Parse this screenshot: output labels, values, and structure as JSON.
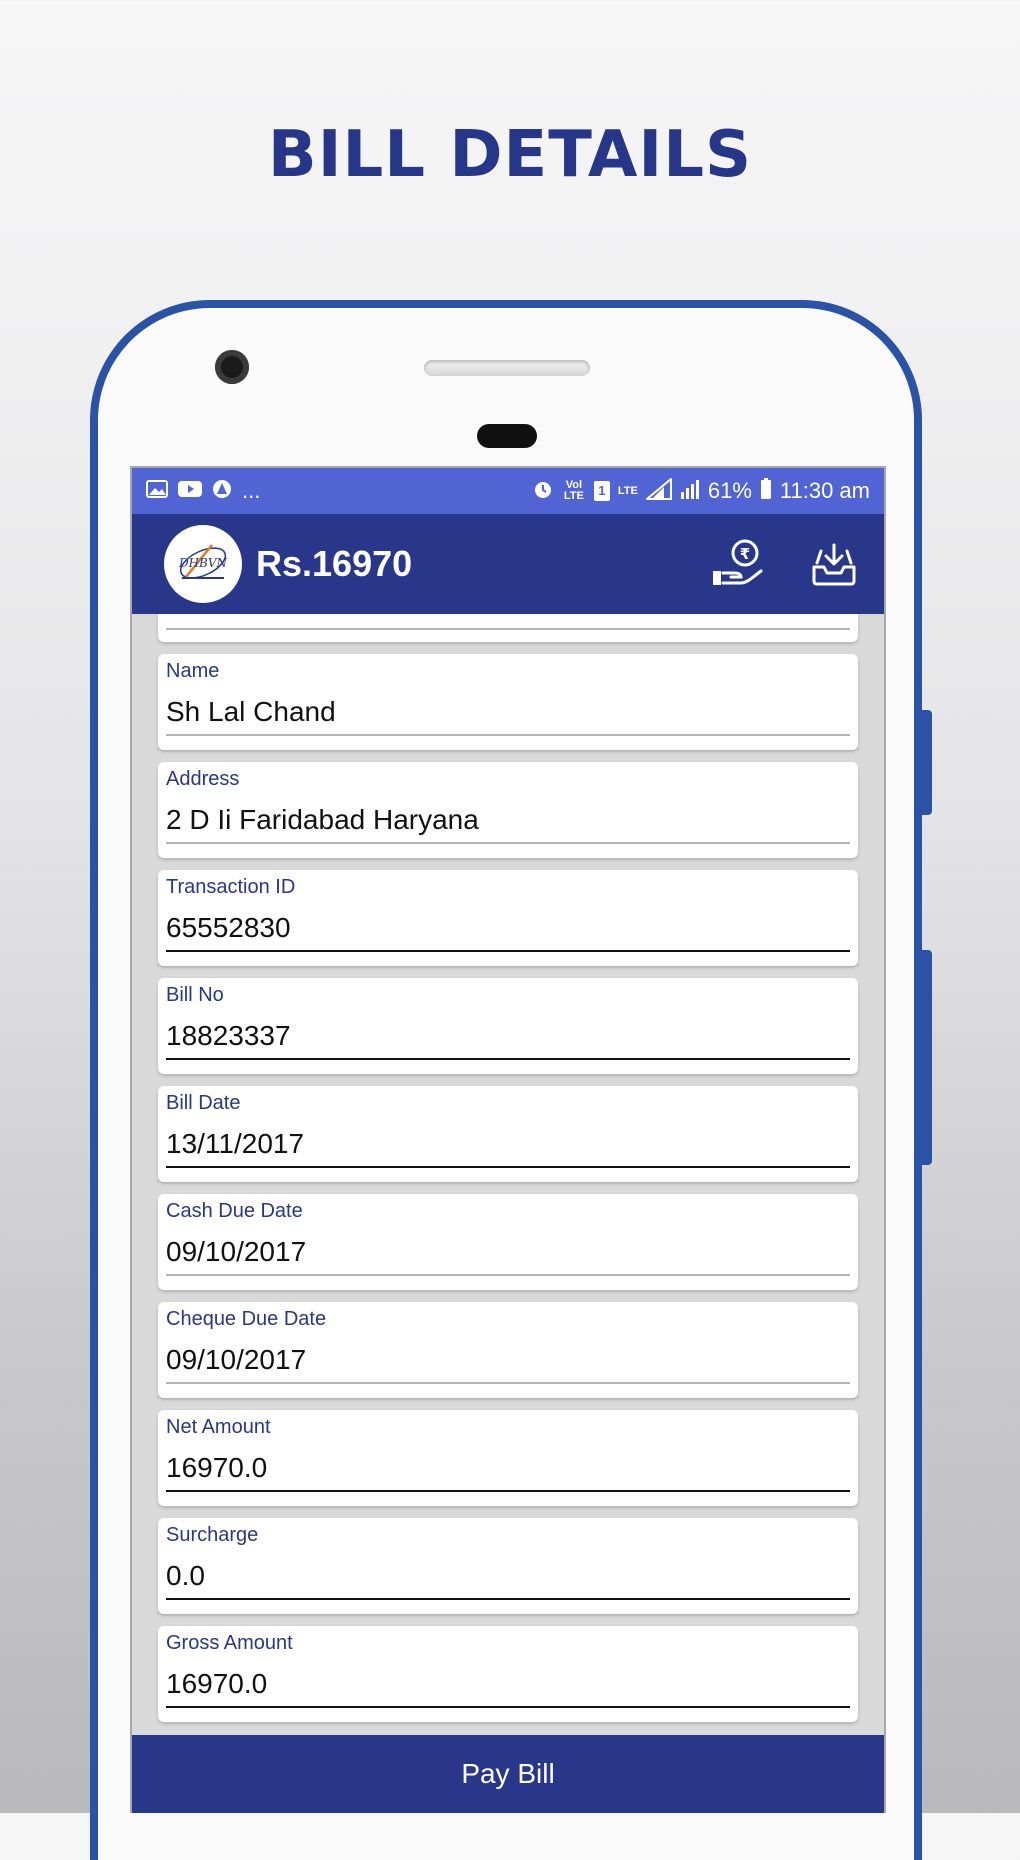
{
  "headline": "BILL DETAILS",
  "status_bar": {
    "battery": "61%",
    "time": "11:30 am",
    "more": "...",
    "volte": "Vol LTE",
    "sim": "1",
    "lte": "LTE"
  },
  "app_bar": {
    "amount": "Rs.16970",
    "logo_text": "DHBVN",
    "icons": [
      "pay-rupee-icon",
      "download-icon"
    ]
  },
  "fields": [
    {
      "label": "Name",
      "value": "Sh Lal Chand",
      "underline": "light"
    },
    {
      "label": "Address",
      "value": "2 D Ii Faridabad  Haryana",
      "underline": "light"
    },
    {
      "label": "Transaction ID",
      "value": "65552830",
      "underline": "dark"
    },
    {
      "label": "Bill No",
      "value": "18823337",
      "underline": "dark"
    },
    {
      "label": "Bill Date",
      "value": "13/11/2017",
      "underline": "dark"
    },
    {
      "label": "Cash Due Date",
      "value": "09/10/2017",
      "underline": "light"
    },
    {
      "label": "Cheque Due Date",
      "value": "09/10/2017",
      "underline": "light"
    },
    {
      "label": "Net Amount",
      "value": "16970.0",
      "underline": "dark"
    },
    {
      "label": "Surcharge",
      "value": "0.0",
      "underline": "dark"
    },
    {
      "label": "Gross Amount",
      "value": "16970.0",
      "underline": "dark"
    }
  ],
  "pay_button": "Pay Bill",
  "colors": {
    "primary": "#283789",
    "status_bar": "#5164d4",
    "phone_frame": "#2a53a7",
    "label": "#283789"
  }
}
